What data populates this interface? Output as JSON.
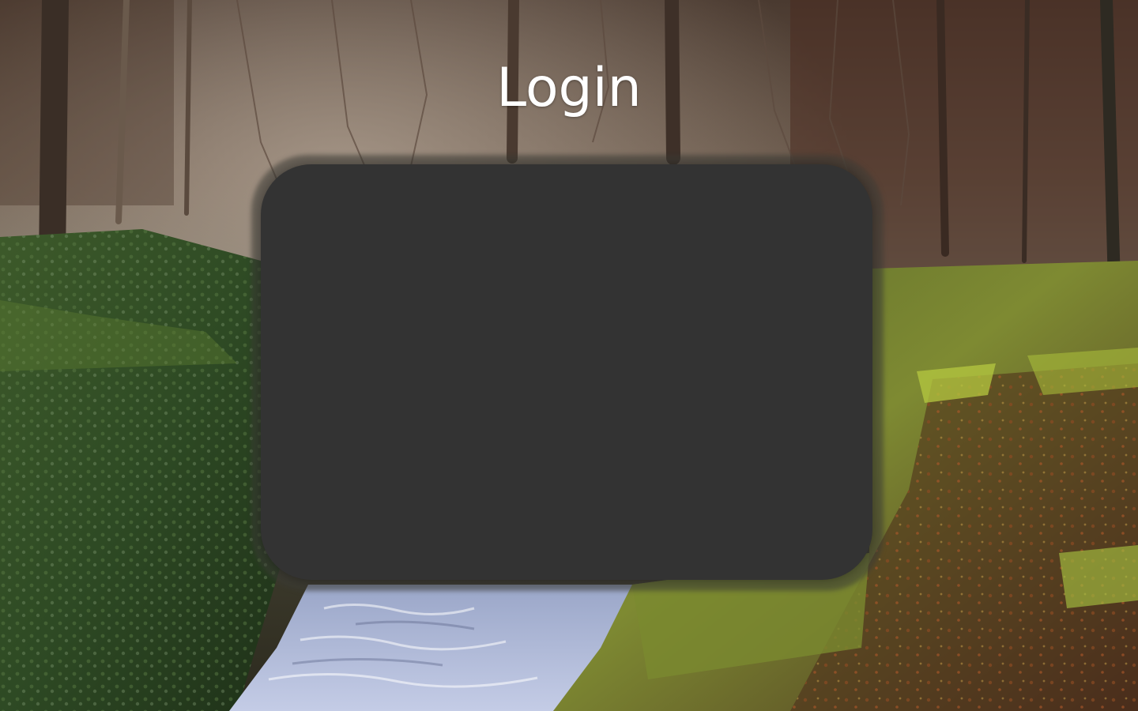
{
  "page": {
    "title": "Login"
  },
  "background": {
    "description_icon": "forest-stream-photo"
  },
  "colors": {
    "card": "#333333",
    "title": "#ffffff"
  }
}
